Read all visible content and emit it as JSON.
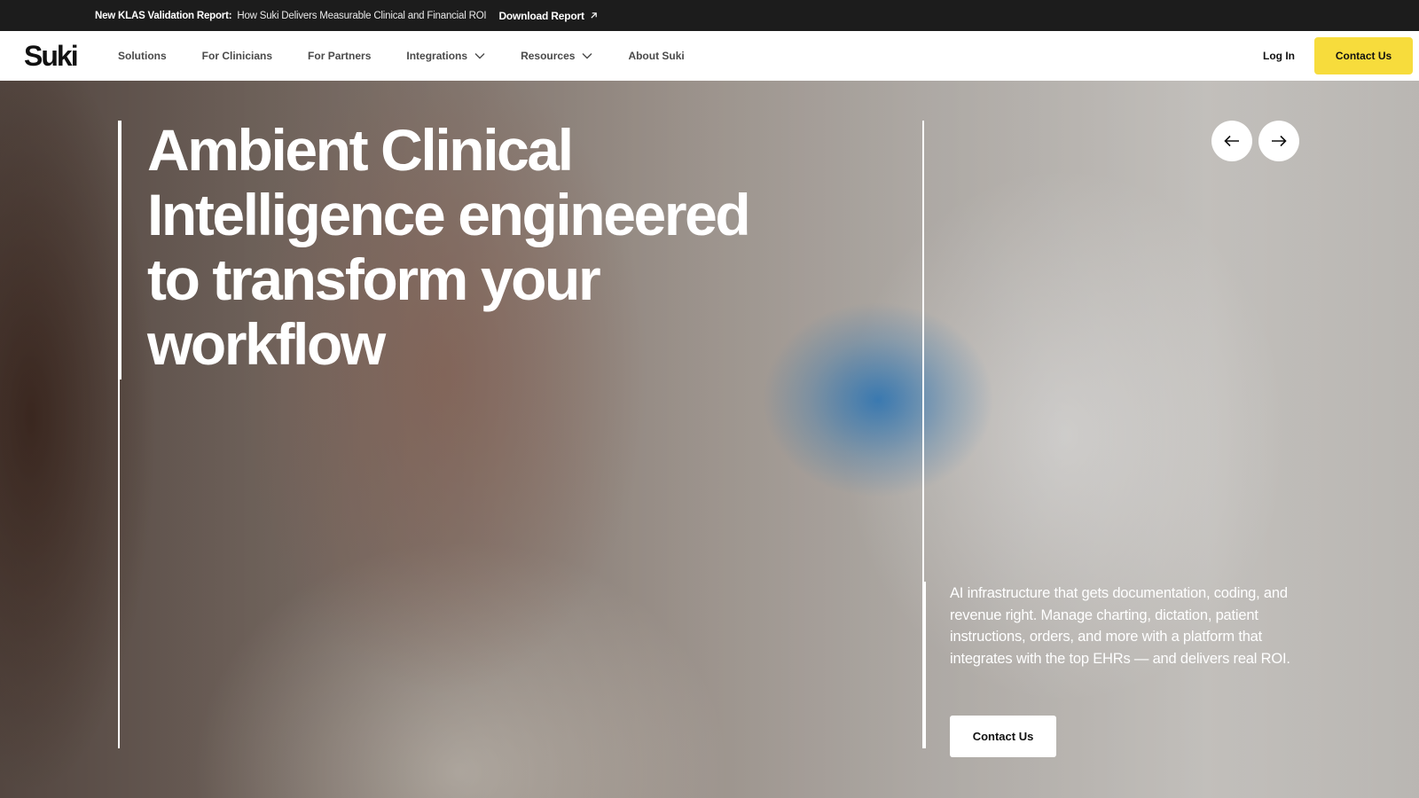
{
  "announcement": {
    "label": "New KLAS Validation Report:",
    "text": "How Suki Delivers Measurable Clinical and Financial ROI",
    "link": "Download Report",
    "link_icon": "arrow-up-right-icon"
  },
  "nav": {
    "logo": "Suki",
    "items": [
      {
        "label": "Solutions"
      },
      {
        "label": "For Clinicians"
      },
      {
        "label": "For Partners"
      },
      {
        "label": "Integrations",
        "icon": "chevron-down-icon"
      },
      {
        "label": "Resources",
        "icon": "chevron-down-icon"
      },
      {
        "label": "About Suki"
      }
    ],
    "login": "Log In",
    "contact": "Contact Us",
    "contact_color": "#f7dc3c"
  },
  "hero": {
    "headline": "Ambient Clinical Intelligence engineered to transform your workflow",
    "description": "AI infrastructure that gets documentation, coding, and revenue right. Manage charting, dictation, patient instructions, orders, and more with a platform that integrates with the top EHRs — and delivers real ROI.",
    "cta": "Contact Us",
    "prev_icon": "arrow-left-icon",
    "next_icon": "arrow-right-icon"
  }
}
